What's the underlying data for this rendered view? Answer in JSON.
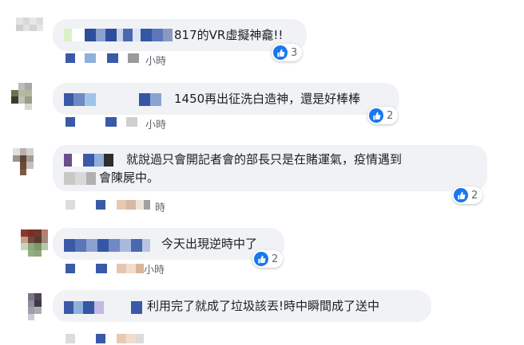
{
  "comments": [
    {
      "text": "817的VR虛擬神龕!!",
      "time": "小時",
      "likes": "3"
    },
    {
      "text": "1450再出征洗白造神，還是好棒棒",
      "time": "小時",
      "likes": "2"
    },
    {
      "text_line1": "就說過只會開記者會的部長只是在賭運氣，疫情遇到",
      "text_line2": "會陳屍中。",
      "time": "時",
      "likes": "2"
    },
    {
      "text": "今天出現逆時中了",
      "time": "小時",
      "likes": "2"
    },
    {
      "text": "利用完了就成了垃圾該丟!時中瞬間成了送中"
    }
  ],
  "colors": {
    "accent": "#1877f2",
    "bubble": "#f0f2f5"
  }
}
